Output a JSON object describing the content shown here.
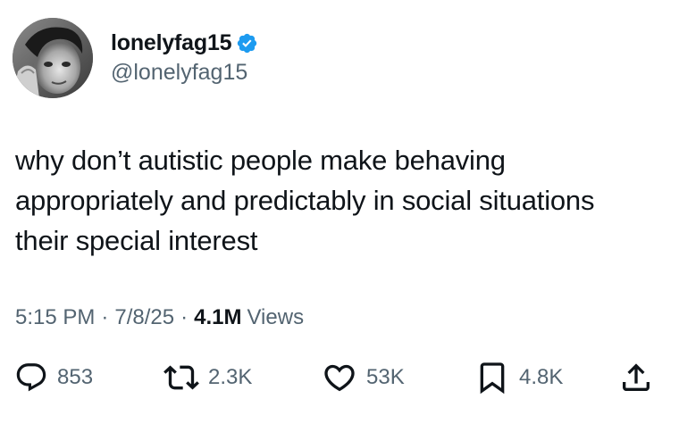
{
  "user": {
    "display_name": "lonelyfag15",
    "handle": "@lonelyfag15",
    "verified_color": "#1d9bf0"
  },
  "tweet": {
    "text": "why don’t autistic people make behaving\nappropriately and predictably in social situations\ntheir special interest"
  },
  "meta": {
    "time": "5:15 PM",
    "separator": "·",
    "date": "7/8/25",
    "views_count": "4.1M",
    "views_label": "Views"
  },
  "actions": {
    "reply_icon": "reply-icon",
    "replies": "853",
    "retweet_icon": "retweet-icon",
    "retweets": "2.3K",
    "like_icon": "like-icon",
    "likes": "53K",
    "bookmark_icon": "bookmark-icon",
    "bookmarks": "4.8K",
    "share_icon": "share-icon"
  },
  "colors": {
    "text": "#0f1419",
    "secondary": "#536471",
    "verified": "#1d9bf0"
  }
}
